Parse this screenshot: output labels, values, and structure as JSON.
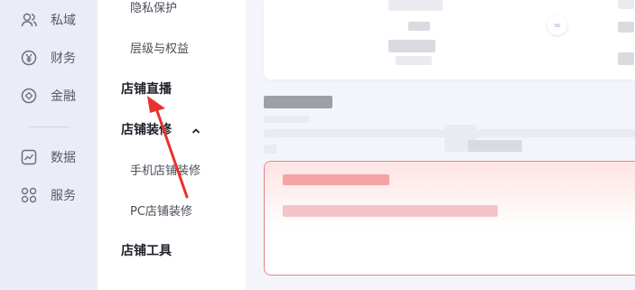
{
  "nav": {
    "items": [
      {
        "label": "私域",
        "icon": "users-icon"
      },
      {
        "label": "财务",
        "icon": "yen-circle-icon"
      },
      {
        "label": "金融",
        "icon": "finance-diamond-icon"
      },
      {
        "label": "数据",
        "icon": "line-chart-icon"
      },
      {
        "label": "服务",
        "icon": "grid-apps-icon"
      }
    ]
  },
  "submenu": {
    "privacy": "隐私保护",
    "levels": "层级与权益",
    "live": "店铺直播",
    "decoration": "店铺装修",
    "mobile_decoration": "手机店铺装修",
    "pc_decoration": "PC店铺装修",
    "tools": "店铺工具"
  },
  "content": {
    "circle_button_symbol": "="
  },
  "colors": {
    "annotation_arrow": "#e8322f",
    "card_border": "#e08585"
  }
}
